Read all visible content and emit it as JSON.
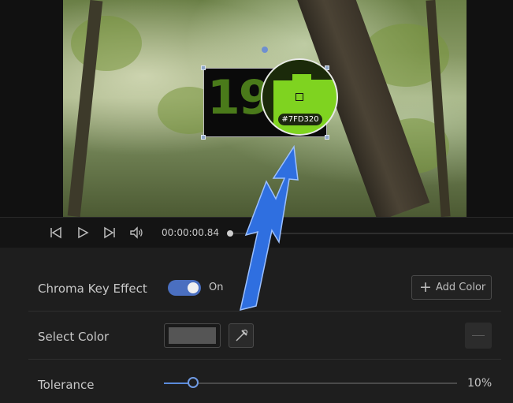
{
  "preview": {
    "overlay_text": "19",
    "picker": {
      "hex_label": "#7FD320",
      "sampled_color": "#7FD320"
    }
  },
  "player": {
    "timecode": "00:00:00.84",
    "icons": [
      "skip-back-icon",
      "play-icon",
      "skip-forward-icon",
      "volume-icon"
    ]
  },
  "chroma_key": {
    "effect_label": "Chroma Key Effect",
    "toggle_state": "On",
    "toggle_on": true,
    "add_color_label": "Add Color",
    "select_color_label": "Select Color",
    "selected_swatch_color": "#555555",
    "tolerance_label": "Tolerance",
    "tolerance_value": "10%",
    "tolerance_fraction": 0.1
  },
  "colors": {
    "accent": "#4A6FC0",
    "annotation_arrow": "#3A78E8"
  }
}
